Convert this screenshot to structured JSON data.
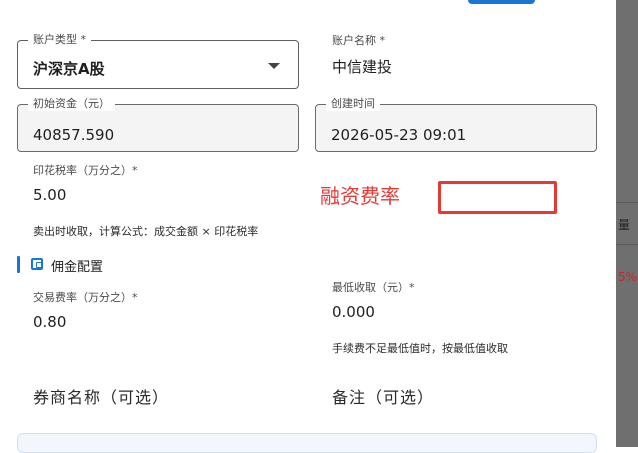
{
  "form": {
    "account_type": {
      "label": "账户类型 *",
      "value": "沪深京A股"
    },
    "account_name": {
      "label": "账户名称 *",
      "value": "中信建投"
    },
    "initial_funds": {
      "label": "初始资金（元）",
      "value": "40857.590"
    },
    "created_time": {
      "label": "创建时间",
      "value": "2026-05-23 09:01"
    },
    "stamp_duty": {
      "label": "印花税率（万分之）*",
      "value": "5.00",
      "helper": "卖出时收取，计算公式：成交金额 × 印花税率"
    },
    "commission_section": {
      "title": "佣金配置"
    },
    "trade_fee_rate": {
      "label": "交易费率（万分之）*",
      "value": "0.80"
    },
    "min_charge": {
      "label": "最低收取（元）*",
      "value": "0.000",
      "helper": "手续费不足最低值时，按最低值收取"
    },
    "broker_name": {
      "label": "券商名称（可选）"
    },
    "remarks": {
      "label": "备注（可选）"
    }
  },
  "annotation": {
    "text": "融资费率",
    "color": "#e53935"
  },
  "backdrop": {
    "fragments": [
      "量",
      "5%"
    ]
  },
  "colors": {
    "accent": "#1976d2",
    "annotation": "#e53935"
  },
  "icons": {
    "section": "wallet-icon",
    "select": "chevron-down-icon"
  }
}
